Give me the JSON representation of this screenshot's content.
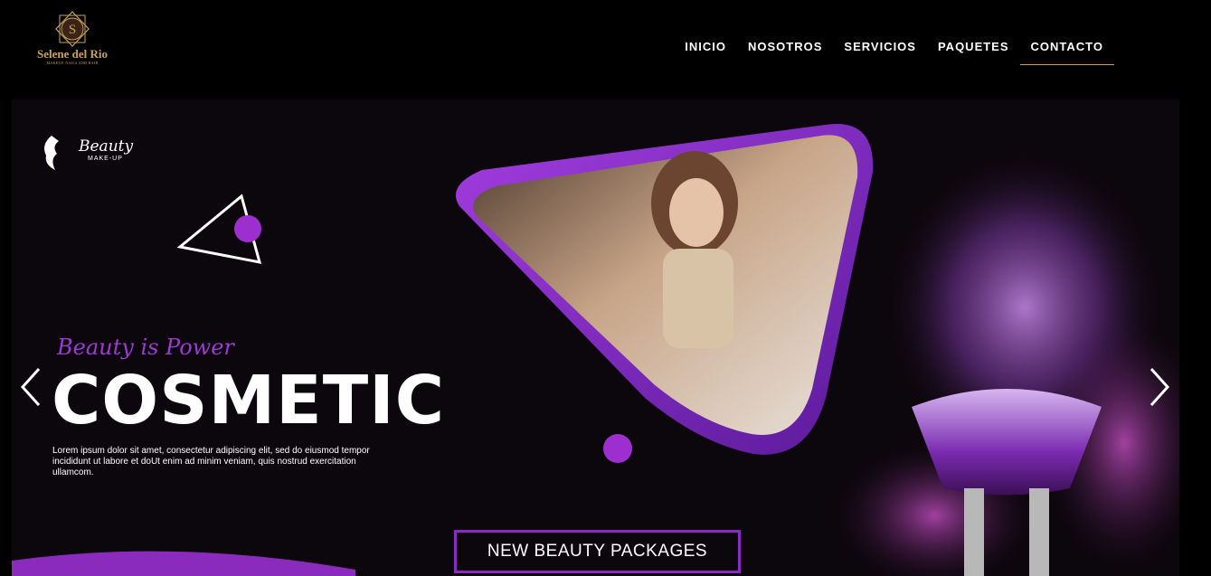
{
  "logo": {
    "letter": "S",
    "name": "Selene del Rio",
    "subtitle": "MAKEUP, NAILS AND HAIR"
  },
  "nav": {
    "items": [
      "INICIO",
      "NOSOTROS",
      "SERVICIOS",
      "PAQUETES",
      "CONTACTO"
    ],
    "active": "CONTACTO"
  },
  "hero": {
    "brand_word": "Beauty",
    "brand_sub": "MAKE-UP",
    "tagline": "Beauty is Power",
    "headline": "COSMETIC",
    "description": "Lorem ipsum dolor sit amet, consectetur adipiscing elit, sed do eiusmod tempor incididunt ut labore et doUt enim ad minim veniam, quis nostrud exercitation ullamcom.",
    "cta": "NEW BEAUTY PACKAGES"
  },
  "icons": {
    "prev": "chevron-left-icon",
    "next": "chevron-right-icon",
    "brand": "woman-silhouette-icon"
  },
  "colors": {
    "accent_purple": "#8a2bbd",
    "gold": "#c9a15a",
    "background": "#000000"
  }
}
